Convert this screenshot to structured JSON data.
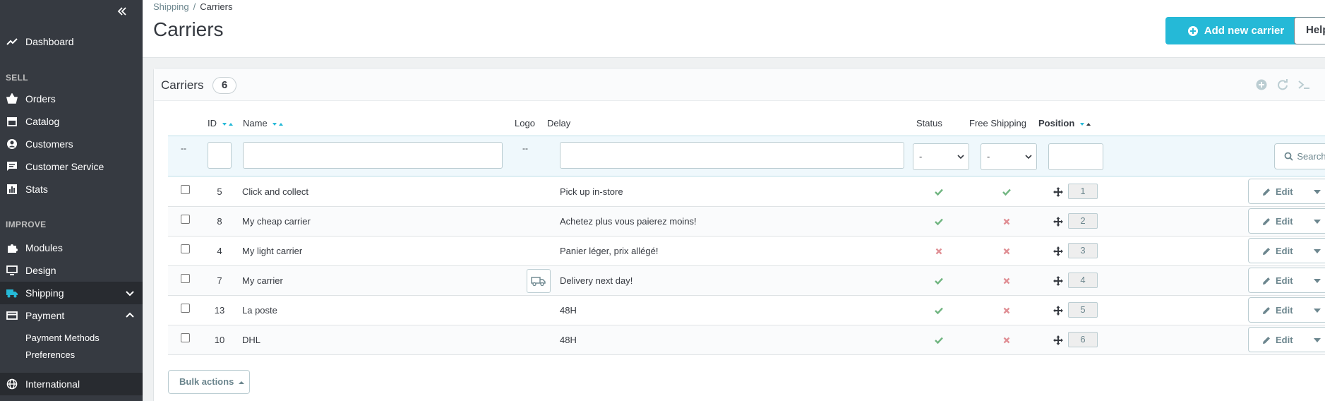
{
  "sidebar": {
    "dashboard": "Dashboard",
    "sections": {
      "sell": "SELL",
      "improve": "IMPROVE"
    },
    "items": {
      "orders": "Orders",
      "catalog": "Catalog",
      "customers": "Customers",
      "customer_service": "Customer Service",
      "stats": "Stats",
      "modules": "Modules",
      "design": "Design",
      "shipping": "Shipping",
      "payment": "Payment",
      "international": "International"
    },
    "payment_sub": [
      "Payment Methods",
      "Preferences"
    ],
    "accent": "#25b9d7"
  },
  "header": {
    "breadcrumb": [
      "Shipping",
      "Carriers"
    ],
    "breadcrumb_sep": "/",
    "title": "Carriers",
    "add_button": "Add new carrier",
    "help_button": "Help"
  },
  "panel": {
    "title": "Carriers",
    "count": "6"
  },
  "table": {
    "headers": {
      "id": "ID",
      "name": "Name",
      "logo": "Logo",
      "delay": "Delay",
      "status": "Status",
      "free_shipping": "Free Shipping",
      "position": "Position"
    },
    "filters": {
      "dash1": "--",
      "dash2": "--",
      "status_select": "-",
      "free_select": "-",
      "search_button": "Search"
    },
    "rows": [
      {
        "id": "5",
        "name": "Click and collect",
        "delay": "Pick up in-store",
        "status": true,
        "free": true,
        "position": "1",
        "logo": false
      },
      {
        "id": "8",
        "name": "My cheap carrier",
        "delay": "Achetez plus vous paierez moins!",
        "status": true,
        "free": false,
        "position": "2",
        "logo": false
      },
      {
        "id": "4",
        "name": "My light carrier",
        "delay": "Panier léger, prix allégé!",
        "status": false,
        "free": false,
        "position": "3",
        "logo": false
      },
      {
        "id": "7",
        "name": "My carrier",
        "delay": "Delivery next day!",
        "status": true,
        "free": false,
        "position": "4",
        "logo": true
      },
      {
        "id": "13",
        "name": "La poste",
        "delay": "48H",
        "status": true,
        "free": false,
        "position": "5",
        "logo": false
      },
      {
        "id": "10",
        "name": "DHL",
        "delay": "48H",
        "status": true,
        "free": false,
        "position": "6",
        "logo": false
      }
    ],
    "edit_label": "Edit"
  },
  "bulk_actions": "Bulk actions",
  "colors": {
    "check": "#70b580",
    "cross": "#e08f95",
    "accent": "#25b9d7",
    "sidebar_bg": "#363a41"
  }
}
